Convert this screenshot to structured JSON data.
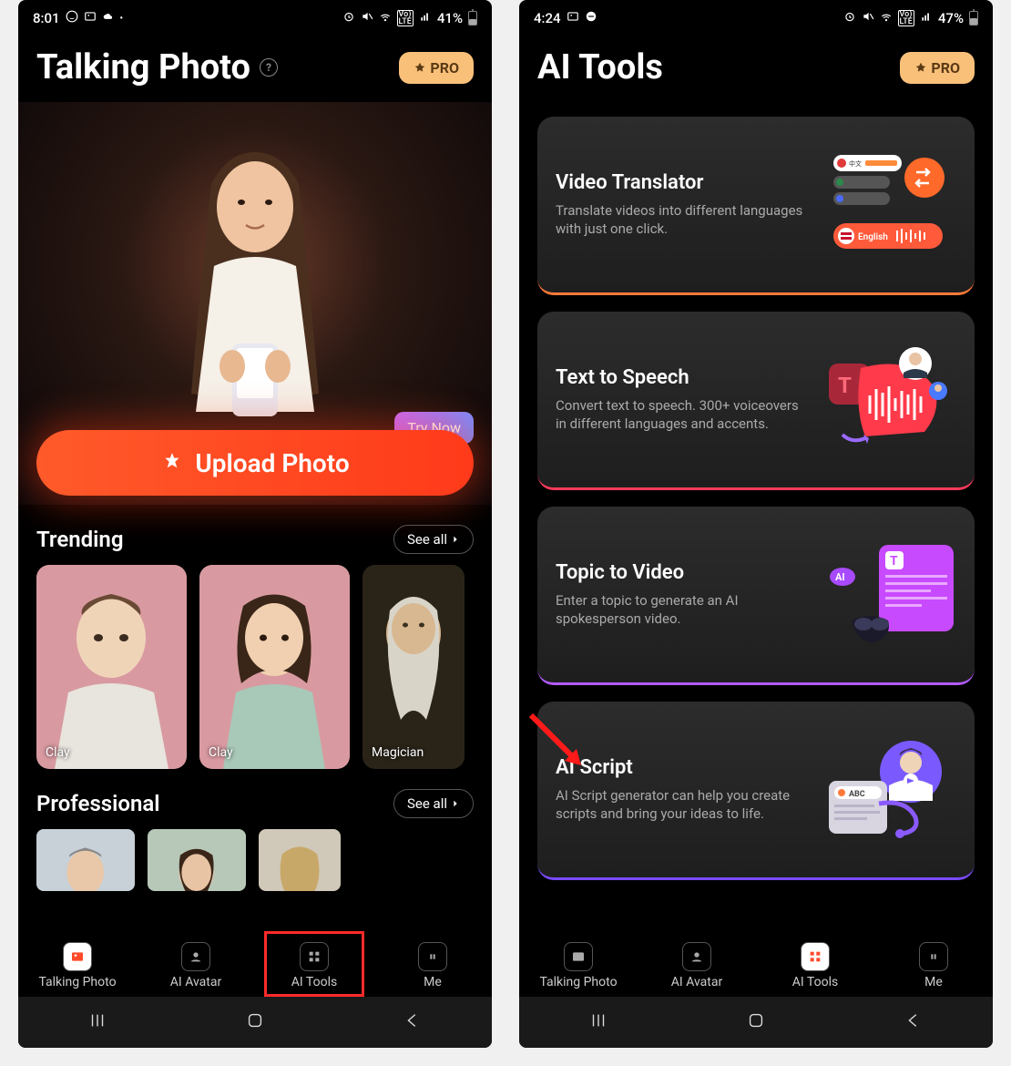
{
  "left": {
    "status": {
      "time": "8:01",
      "battery": "41%"
    },
    "header": {
      "title": "Talking Photo",
      "pro": "PRO"
    },
    "hero": {
      "try": "Try Now",
      "upload": "Upload Photo"
    },
    "sections": [
      {
        "title": "Trending",
        "see_all": "See all",
        "items": [
          "Clay",
          "Clay",
          "Magician"
        ]
      },
      {
        "title": "Professional",
        "see_all": "See all",
        "items": [
          "",
          "",
          ""
        ]
      }
    ],
    "nav": [
      "Talking Photo",
      "AI Avatar",
      "AI Tools",
      "Me"
    ]
  },
  "right": {
    "status": {
      "time": "4:24",
      "battery": "47%"
    },
    "header": {
      "title": "AI Tools",
      "pro": "PRO"
    },
    "tools": [
      {
        "title": "Video Translator",
        "desc": "Translate videos into different languages with just one click.",
        "color": "orange"
      },
      {
        "title": "Text to Speech",
        "desc": "Convert text to speech. 300+ voiceovers in different languages and accents.",
        "color": "red"
      },
      {
        "title": "Topic to Video",
        "desc": "Enter a topic to generate an AI spokesperson video.",
        "color": "purple"
      },
      {
        "title": "AI Script",
        "desc": "AI Script generator can help you create scripts and bring your ideas to life.",
        "color": "violet"
      }
    ],
    "nav": [
      "Talking Photo",
      "AI Avatar",
      "AI Tools",
      "Me"
    ]
  }
}
